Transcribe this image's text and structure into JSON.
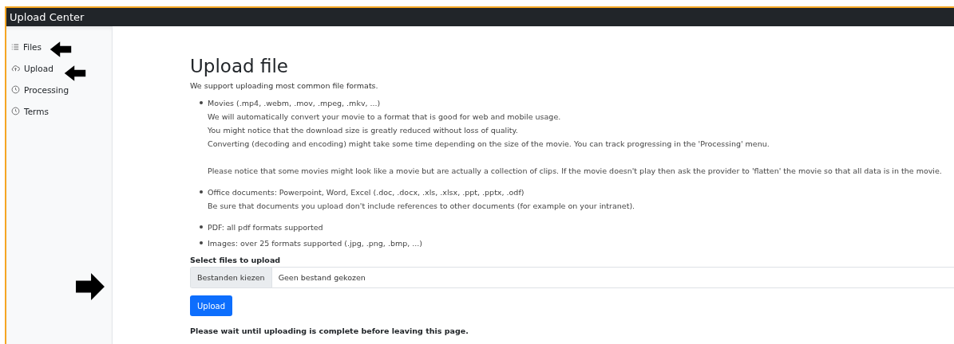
{
  "app_title": "Upload Center",
  "sidebar": {
    "items": [
      {
        "label": "Files"
      },
      {
        "label": "Upload"
      },
      {
        "label": "Processing"
      },
      {
        "label": "Terms"
      }
    ]
  },
  "page": {
    "title": "Upload file",
    "intro": "We support uploading most common file formats.",
    "bullets": [
      {
        "paragraphs": [
          [
            "Movies (.mp4, .webm, .mov, .mpeg, .mkv, ...)",
            "We will automatically convert your movie to a format that is good for web and mobile usage.",
            "You might notice that the download size is greatly reduced without loss of quality.",
            "Converting (decoding and encoding) might take some time depending on the size of the movie. You can track progressing in the 'Processing' menu."
          ],
          [
            "Please notice that some movies might look like a movie but are actually a collection of clips. If the movie doesn't play then ask the provider to 'flatten' the movie so that all data is in the movie."
          ]
        ]
      },
      {
        "paragraphs": [
          [
            "Office documents: Powerpoint, Word, Excel (.doc, .docx, .xls, .xlsx, .ppt, .pptx, .odf)",
            "Be sure that documents you upload don't include references to other documents (for example on your intranet)."
          ]
        ]
      },
      {
        "paragraphs": [
          [
            "PDF: all pdf formats supported"
          ]
        ]
      },
      {
        "paragraphs": [
          [
            "Images: over 25 formats supported (.jpg, .png, .bmp, ...)"
          ]
        ]
      }
    ],
    "file_label": "Select files to upload",
    "file_button": "Bestanden kiezen",
    "file_status": "Geen bestand gekozen",
    "upload_button": "Upload",
    "note": "Please wait until uploading is complete before leaving this page."
  }
}
